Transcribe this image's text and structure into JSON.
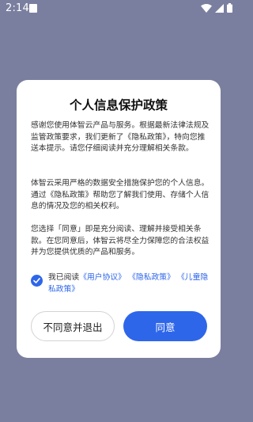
{
  "status_bar": {
    "time": "2:14",
    "icons": [
      "notification-square-icon",
      "wifi-icon",
      "signal-icon",
      "battery-icon"
    ]
  },
  "dialog": {
    "title": "个人信息保护政策",
    "paragraphs": [
      "感谢您使用体智云产品与服务。根据最新法律法规及监管政策要求，我们更新了《隐私政策》，特向您推送本提示。请您仔细阅读并充分理解相关条款。",
      "体智云采用严格的数据安全措施保护您的个人信息。通过《隐私政策》帮助您了解我们使用、存储个人信息的情况及您的相关权利。",
      "您选择「同意」即是充分阅读、理解并接受相关条款。在您同意后，体智云将尽全力保障您的合法权益并为您提供优质的产品和服务。"
    ],
    "agreement": {
      "checked": true,
      "prefix": "我已阅读",
      "user_agreement": "《用户协议》",
      "privacy_policy": "《隐私政策》",
      "children_policy": "《儿童隐私政策》"
    },
    "buttons": {
      "decline": "不同意并退出",
      "agree": "同意"
    }
  },
  "colors": {
    "accent": "#2e66ea",
    "overlay": "#7b7f9f"
  }
}
